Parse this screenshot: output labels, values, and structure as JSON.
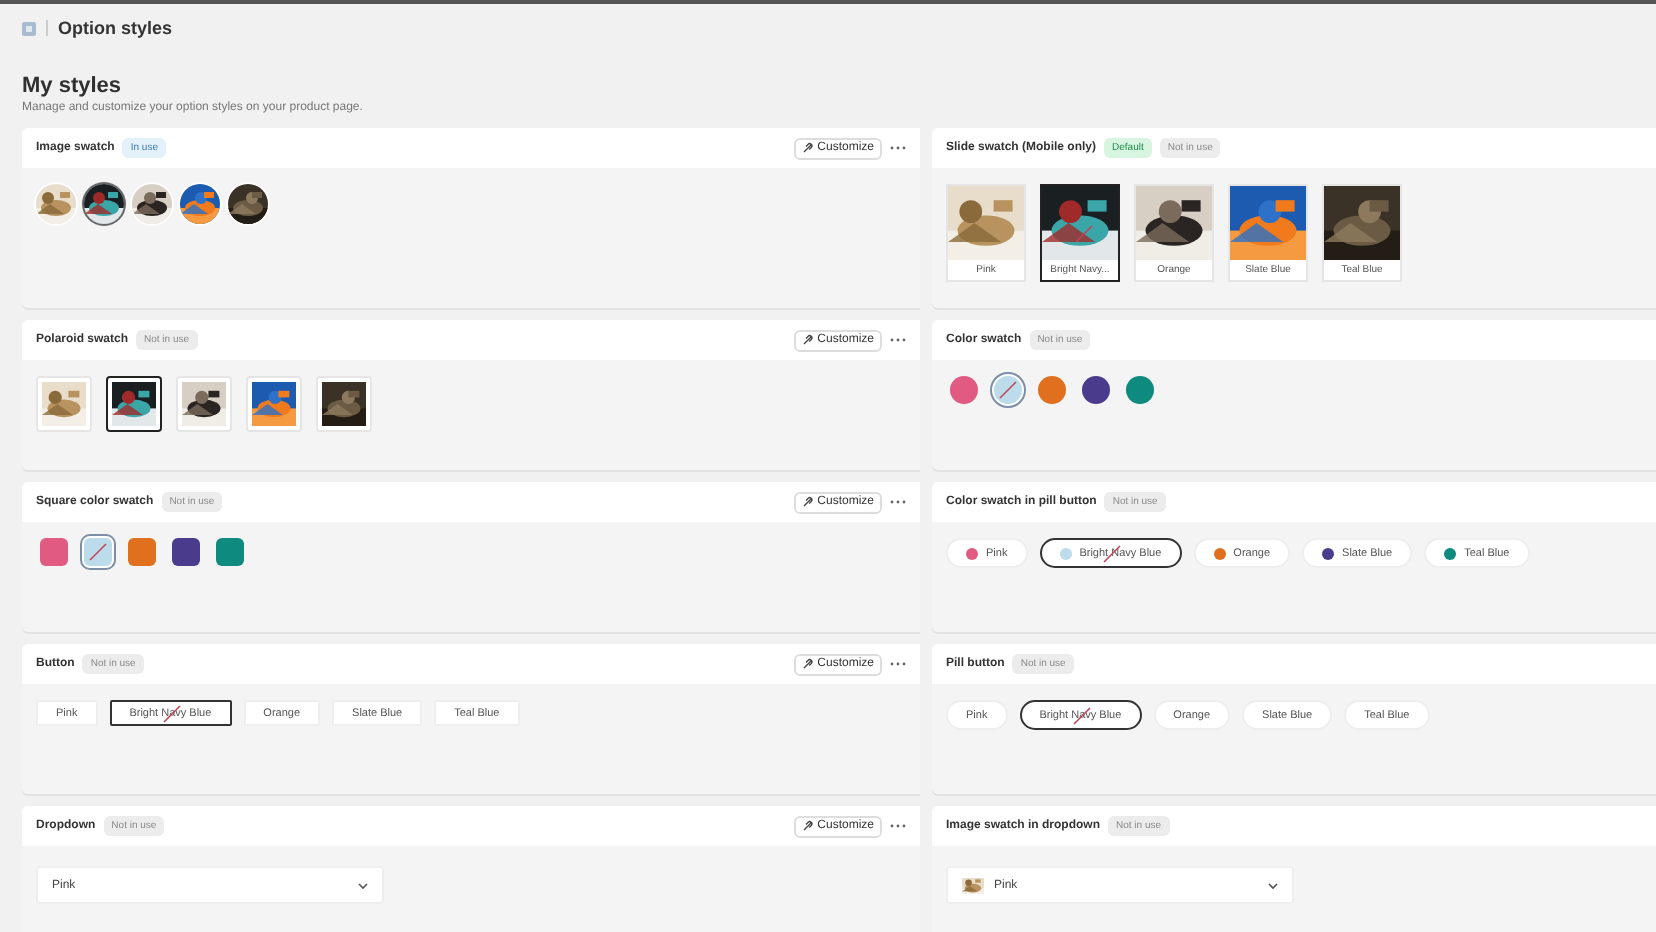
{
  "breadcrumb": {
    "title": "Option styles"
  },
  "heading": "My styles",
  "subtitle": "Manage and customize your option styles on your product page.",
  "cards": [
    {
      "title": "Image swatch",
      "badges": [
        {
          "label": "In use",
          "kind": "info"
        }
      ],
      "action": "Customize",
      "kind": "image-circle",
      "options": [
        {
          "selected": false
        },
        {
          "selected": true
        },
        {
          "selected": false
        },
        {
          "selected": false
        },
        {
          "selected": false
        }
      ]
    },
    {
      "title": "Slide swatch (Mobile only)",
      "badges": [
        {
          "label": "Default",
          "kind": "success"
        },
        {
          "label": "Not in use",
          "kind": "neutral"
        }
      ],
      "kind": "image-slide",
      "options": [
        {
          "label": "Pink",
          "selected": false,
          "sold_out": false
        },
        {
          "label": "Bright Navy...",
          "selected": true,
          "sold_out": true
        },
        {
          "label": "Orange",
          "selected": false,
          "sold_out": false
        },
        {
          "label": "Slate Blue",
          "selected": false,
          "sold_out": false
        },
        {
          "label": "Teal Blue",
          "selected": false,
          "sold_out": false
        }
      ]
    },
    {
      "title": "Polaroid swatch",
      "badges": [
        {
          "label": "Not in use",
          "kind": "neutral"
        }
      ],
      "action": "Customize",
      "kind": "image-square",
      "options": [
        {
          "selected": false
        },
        {
          "selected": true
        },
        {
          "selected": false
        },
        {
          "selected": false
        },
        {
          "selected": false
        }
      ]
    },
    {
      "title": "Color swatch",
      "badges": [
        {
          "label": "Not in use",
          "kind": "neutral"
        }
      ],
      "kind": "color-circle",
      "options": [
        {
          "color": "#e05a82",
          "selected": false,
          "sold_out": false
        },
        {
          "color": "#bcdcec",
          "selected": true,
          "sold_out": true
        },
        {
          "color": "#e0701e",
          "selected": false,
          "sold_out": false
        },
        {
          "color": "#4a3b8c",
          "selected": false,
          "sold_out": false
        },
        {
          "color": "#0e8a7e",
          "selected": false,
          "sold_out": false
        }
      ]
    },
    {
      "title": "Square color swatch",
      "badges": [
        {
          "label": "Not in use",
          "kind": "neutral"
        }
      ],
      "action": "Customize",
      "kind": "color-square",
      "options": [
        {
          "color": "#e05a82",
          "selected": false,
          "sold_out": false
        },
        {
          "color": "#bcdcec",
          "selected": true,
          "sold_out": true
        },
        {
          "color": "#e0701e",
          "selected": false,
          "sold_out": false
        },
        {
          "color": "#4a3b8c",
          "selected": false,
          "sold_out": false
        },
        {
          "color": "#0e8a7e",
          "selected": false,
          "sold_out": false
        }
      ]
    },
    {
      "title": "Color swatch in pill button",
      "badges": [
        {
          "label": "Not in use",
          "kind": "neutral"
        }
      ],
      "kind": "color-pill",
      "options": [
        {
          "label": "Pink",
          "color": "#e05a82",
          "selected": false,
          "sold_out": false
        },
        {
          "label": "Bright Navy Blue",
          "color": "#bcdcec",
          "selected": true,
          "sold_out": true
        },
        {
          "label": "Orange",
          "color": "#e0701e",
          "selected": false,
          "sold_out": false
        },
        {
          "label": "Slate Blue",
          "color": "#4a3b8c",
          "selected": false,
          "sold_out": false
        },
        {
          "label": "Teal Blue",
          "color": "#0e8a7e",
          "selected": false,
          "sold_out": false
        }
      ]
    },
    {
      "title": "Button",
      "badges": [
        {
          "label": "Not in use",
          "kind": "neutral"
        }
      ],
      "action": "Customize",
      "kind": "button",
      "options": [
        {
          "label": "Pink",
          "selected": false,
          "sold_out": false
        },
        {
          "label": "Bright Navy Blue",
          "selected": true,
          "sold_out": true
        },
        {
          "label": "Orange",
          "selected": false,
          "sold_out": false
        },
        {
          "label": "Slate Blue",
          "selected": false,
          "sold_out": false
        },
        {
          "label": "Teal Blue",
          "selected": false,
          "sold_out": false
        }
      ]
    },
    {
      "title": "Pill button",
      "badges": [
        {
          "label": "Not in use",
          "kind": "neutral"
        }
      ],
      "kind": "pill",
      "options": [
        {
          "label": "Pink",
          "selected": false,
          "sold_out": false
        },
        {
          "label": "Bright Navy Blue",
          "selected": true,
          "sold_out": true
        },
        {
          "label": "Orange",
          "selected": false,
          "sold_out": false
        },
        {
          "label": "Slate Blue",
          "selected": false,
          "sold_out": false
        },
        {
          "label": "Teal Blue",
          "selected": false,
          "sold_out": false
        }
      ]
    },
    {
      "title": "Dropdown",
      "badges": [
        {
          "label": "Not in use",
          "kind": "neutral"
        }
      ],
      "action": "Customize",
      "kind": "dropdown",
      "value": "Pink"
    },
    {
      "title": "Image swatch in dropdown",
      "badges": [
        {
          "label": "Not in use",
          "kind": "neutral"
        }
      ],
      "kind": "image-dropdown",
      "value": "Pink"
    }
  ]
}
